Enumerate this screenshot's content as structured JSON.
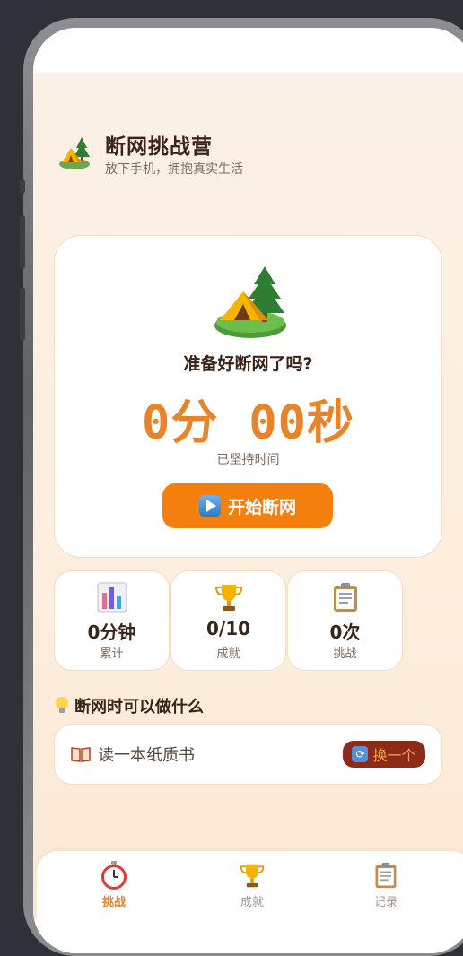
{
  "header": {
    "title": "断网挑战营",
    "subtitle": "放下手机，拥抱真实生活",
    "icon": "camping-tent-icon"
  },
  "timer_card": {
    "prompt": "准备好断网了吗?",
    "minutes": "0分",
    "seconds": "00秒",
    "label": "已坚持时间",
    "start_button": "开始断网"
  },
  "stats": [
    {
      "icon": "bar-chart-icon",
      "value": "0分钟",
      "label": "累计"
    },
    {
      "icon": "trophy-icon",
      "value": "0/10",
      "label": "成就"
    },
    {
      "icon": "clipboard-icon",
      "value": "0次",
      "label": "挑战"
    }
  ],
  "suggestion": {
    "section_title": "断网时可以做什么",
    "text": "读一本纸质书",
    "swap_button": "换一个"
  },
  "tabs": [
    {
      "icon": "stopwatch-icon",
      "label": "挑战",
      "active": true
    },
    {
      "icon": "trophy-icon",
      "label": "成就",
      "active": false
    },
    {
      "icon": "clipboard-icon",
      "label": "记录",
      "active": false
    }
  ],
  "colors": {
    "accent": "#f37f0c",
    "timer": "#e8832a",
    "title_text": "#3a2418",
    "swap_button_bg": "#8e2a18"
  }
}
